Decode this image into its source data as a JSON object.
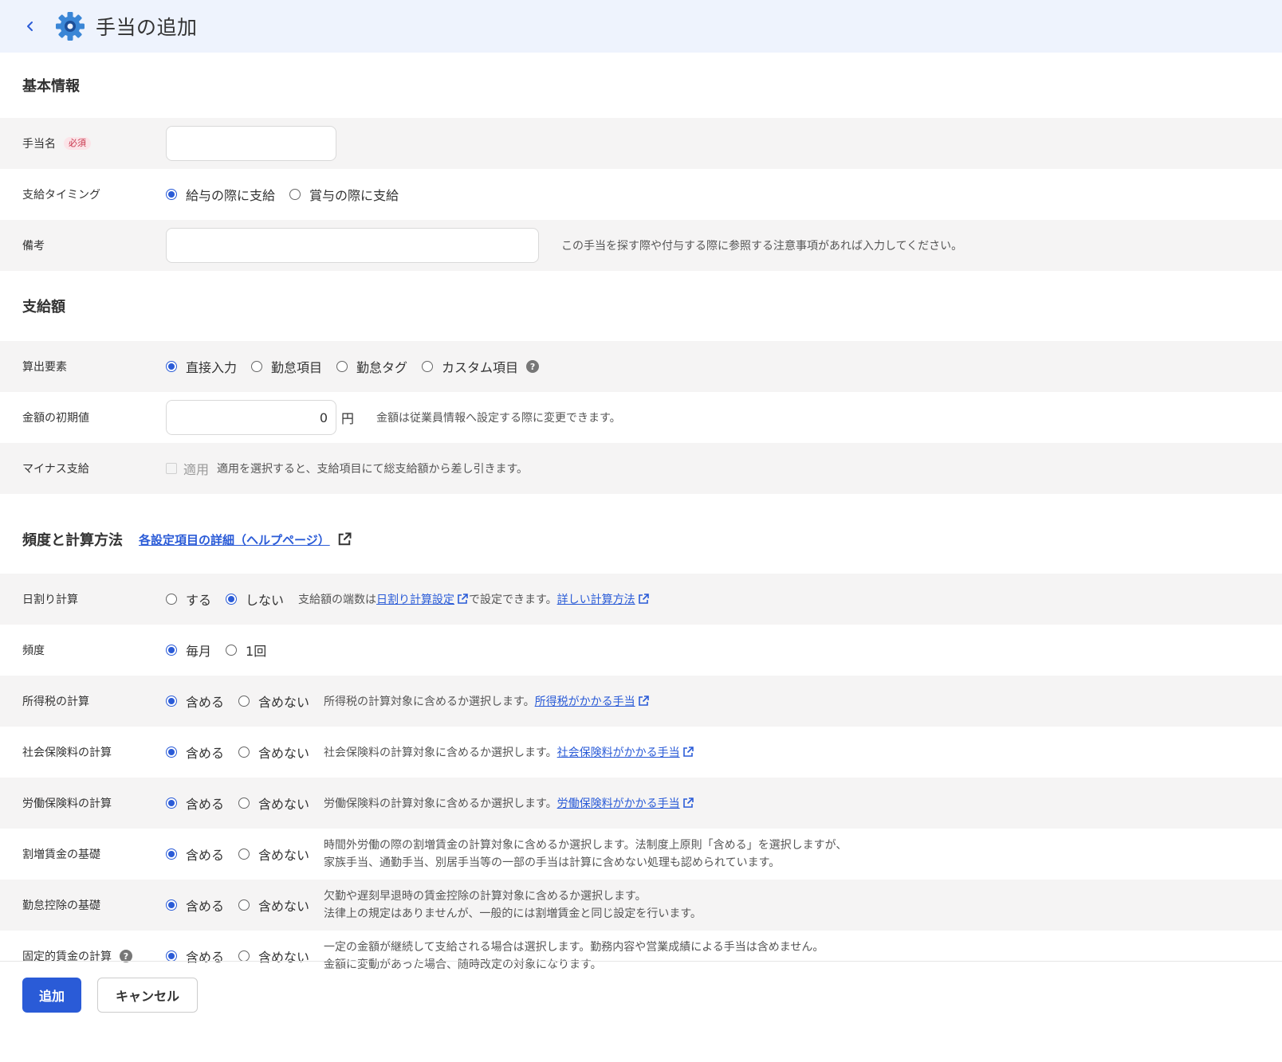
{
  "header": {
    "title": "手当の追加"
  },
  "basic": {
    "title": "基本情報",
    "name_label": "手当名",
    "required": "必須",
    "name_value": "",
    "timing_label": "支給タイミング",
    "timing_options": [
      "給与の際に支給",
      "賞与の際に支給"
    ],
    "note_label": "備考",
    "note_value": "",
    "note_hint": "この手当を探す際や付与する際に参照する注意事項があれば入力してください。"
  },
  "amount": {
    "title": "支給額",
    "calc_label": "算出要素",
    "calc_options": [
      "直接入力",
      "勤怠項目",
      "勤怠タグ",
      "カスタム項目"
    ],
    "default_label": "金額の初期値",
    "default_value": "0",
    "unit": "円",
    "default_hint": "金額は従業員情報へ設定する際に変更できます。",
    "minus_label": "マイナス支給",
    "minus_checkbox": "適用",
    "minus_hint": "適用を選択すると、支給項目にて総支給額から差し引きます。"
  },
  "freq": {
    "title": "頻度と計算方法",
    "help_link": "各設定項目の詳細（ヘルプページ）",
    "daily_label": "日割り計算",
    "daily_options": [
      "する",
      "しない"
    ],
    "daily_hint_1": "支給額の端数は",
    "daily_link_1": "日割り計算設定",
    "daily_hint_2": "で設定できます。",
    "daily_link_2": "詳しい計算方法",
    "freq_label": "頻度",
    "freq_options": [
      "毎月",
      "1回"
    ],
    "include": "含める",
    "exclude": "含めない",
    "income_tax_label": "所得税の計算",
    "income_tax_hint": "所得税の計算対象に含めるか選択します。",
    "income_tax_link": "所得税がかかる手当",
    "social_label": "社会保険料の計算",
    "social_hint": "社会保険料の計算対象に含めるか選択します。",
    "social_link": "社会保険料がかかる手当",
    "labor_label": "労働保険料の計算",
    "labor_hint": "労働保険料の計算対象に含めるか選択します。",
    "labor_link": "労働保険料がかかる手当",
    "overtime_label": "割増賃金の基礎",
    "overtime_hint_1": "時間外労働の際の割増賃金の計算対象に含めるか選択します。法制度上原則「含める」を選択しますが、",
    "overtime_hint_2": "家族手当、通勤手当、別居手当等の一部の手当は計算に含めない処理も認められています。",
    "deduction_label": "勤怠控除の基礎",
    "deduction_hint_1": "欠勤や遅刻早退時の賃金控除の計算対象に含めるか選択します。",
    "deduction_hint_2": "法律上の規定はありませんが、一般的には割増賃金と同じ設定を行います。",
    "fixed_label": "固定的賃金の計算",
    "fixed_hint_1": "一定の金額が継続して支給される場合は選択します。勤務内容や営業成績による手当は含めません。",
    "fixed_hint_2": "金額に変動があった場合、随時改定の対象になります。"
  },
  "footer": {
    "add": "追加",
    "cancel": "キャンセル"
  },
  "colors": {
    "accent": "#2a5bd7",
    "header_bg": "#eef3fd",
    "row_alt": "#f5f4f4"
  },
  "icons": {
    "header": "gear-icon",
    "back": "chevron-left-icon",
    "external": "external-link-icon",
    "help": "question-circle-icon"
  }
}
